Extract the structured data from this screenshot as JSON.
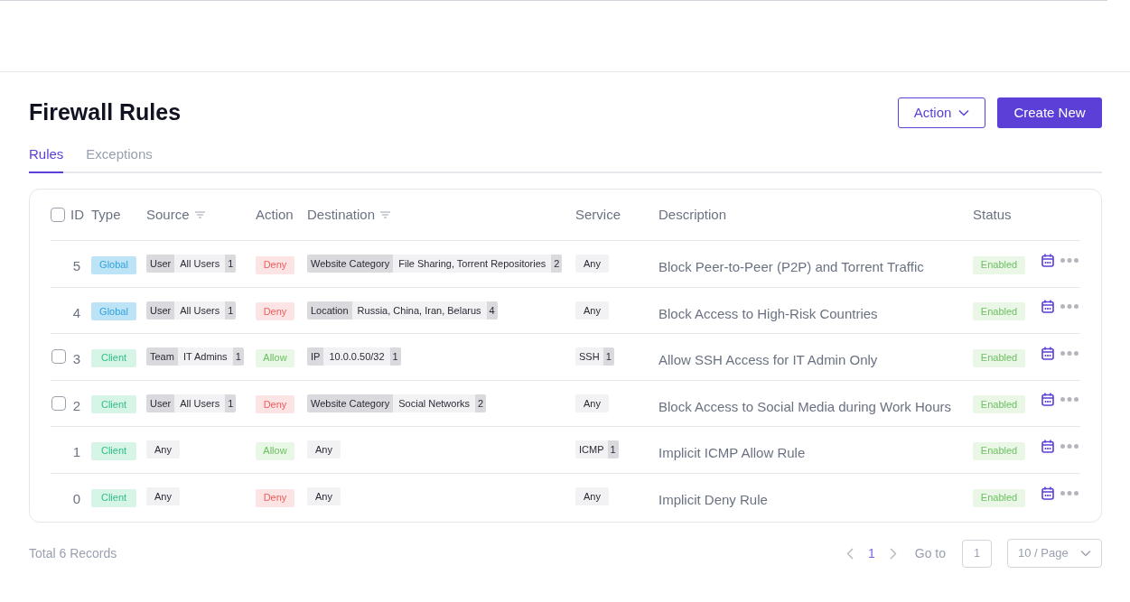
{
  "title": "Firewall Rules",
  "header_buttons": [
    {
      "kind": "outline",
      "label": "Action"
    },
    {
      "kind": "primary",
      "label": "Create New"
    }
  ],
  "tabs": [
    {
      "label": "Rules",
      "selected": true
    },
    {
      "label": "Exceptions",
      "selected": false
    }
  ],
  "table": {
    "select_all": {
      "checked": false
    },
    "columns": [
      {
        "label": "ID"
      },
      {
        "label": "Type"
      },
      {
        "label": "Source",
        "filter": true
      },
      {
        "label": "Action"
      },
      {
        "label": "Destination",
        "filter": true
      },
      {
        "label": "Service"
      },
      {
        "label": "Description"
      },
      {
        "label": "Status"
      }
    ],
    "rows": [
      {
        "id": "5",
        "type": {
          "kind": "global",
          "label": "Global"
        },
        "source": {
          "kind": "group",
          "label": "User",
          "value": "All Users",
          "count": "1"
        },
        "action": {
          "kind": "deny",
          "label": "Deny"
        },
        "destination": {
          "kind": "group",
          "label": "Website Category",
          "value": "File Sharing, Torrent Repositories",
          "count": "2"
        },
        "service": {
          "kind": "plain",
          "value": "Any"
        },
        "description": "Block Peer-to-Peer (P2P) and Torrent Traffic",
        "status": "Enabled"
      },
      {
        "id": "4",
        "type": {
          "kind": "global",
          "label": "Global"
        },
        "source": {
          "kind": "group",
          "label": "User",
          "value": "All Users",
          "count": "1"
        },
        "action": {
          "kind": "deny",
          "label": "Deny"
        },
        "destination": {
          "kind": "group",
          "label": "Location",
          "value": "Russia, China, Iran, Belarus",
          "count": "4"
        },
        "service": {
          "kind": "plain",
          "value": "Any"
        },
        "description": "Block Access to High-Risk Countries",
        "status": "Enabled"
      },
      {
        "id": "3",
        "checked": false,
        "type": {
          "kind": "client",
          "label": "Client"
        },
        "source": {
          "kind": "group",
          "label": "Team",
          "value": "IT Admins",
          "count": "1"
        },
        "action": {
          "kind": "allow",
          "label": "Allow"
        },
        "destination": {
          "kind": "group",
          "label": "IP",
          "value": "10.0.0.50/32",
          "count": "1"
        },
        "service": {
          "kind": "counted",
          "value": "SSH",
          "count": "1"
        },
        "description": "Allow SSH Access for IT Admin Only",
        "status": "Enabled"
      },
      {
        "id": "2",
        "checked": false,
        "type": {
          "kind": "client",
          "label": "Client"
        },
        "source": {
          "kind": "group",
          "label": "User",
          "value": "All Users",
          "count": "1"
        },
        "action": {
          "kind": "deny",
          "label": "Deny"
        },
        "destination": {
          "kind": "group",
          "label": "Website Category",
          "value": "Social Networks",
          "count": "2"
        },
        "service": {
          "kind": "plain",
          "value": "Any"
        },
        "description": "Block Access to Social Media during Work Hours",
        "status": "Enabled"
      },
      {
        "id": "1",
        "type": {
          "kind": "client",
          "label": "Client"
        },
        "source": {
          "kind": "plain",
          "value": "Any"
        },
        "action": {
          "kind": "allow",
          "label": "Allow"
        },
        "destination": {
          "kind": "plain",
          "value": "Any"
        },
        "service": {
          "kind": "counted",
          "value": "ICMP",
          "count": "1"
        },
        "description": "Implicit ICMP Allow Rule",
        "status": "Enabled"
      },
      {
        "id": "0",
        "type": {
          "kind": "client",
          "label": "Client"
        },
        "source": {
          "kind": "plain",
          "value": "Any"
        },
        "action": {
          "kind": "deny",
          "label": "Deny"
        },
        "destination": {
          "kind": "plain",
          "value": "Any"
        },
        "service": {
          "kind": "plain",
          "value": "Any"
        },
        "description": "Implicit Deny Rule",
        "status": "Enabled"
      }
    ]
  },
  "footer": {
    "total": "Total 6 Records",
    "current_page": "1",
    "goto_label": "Go to",
    "goto_value": "1",
    "page_size": "10 / Page"
  }
}
